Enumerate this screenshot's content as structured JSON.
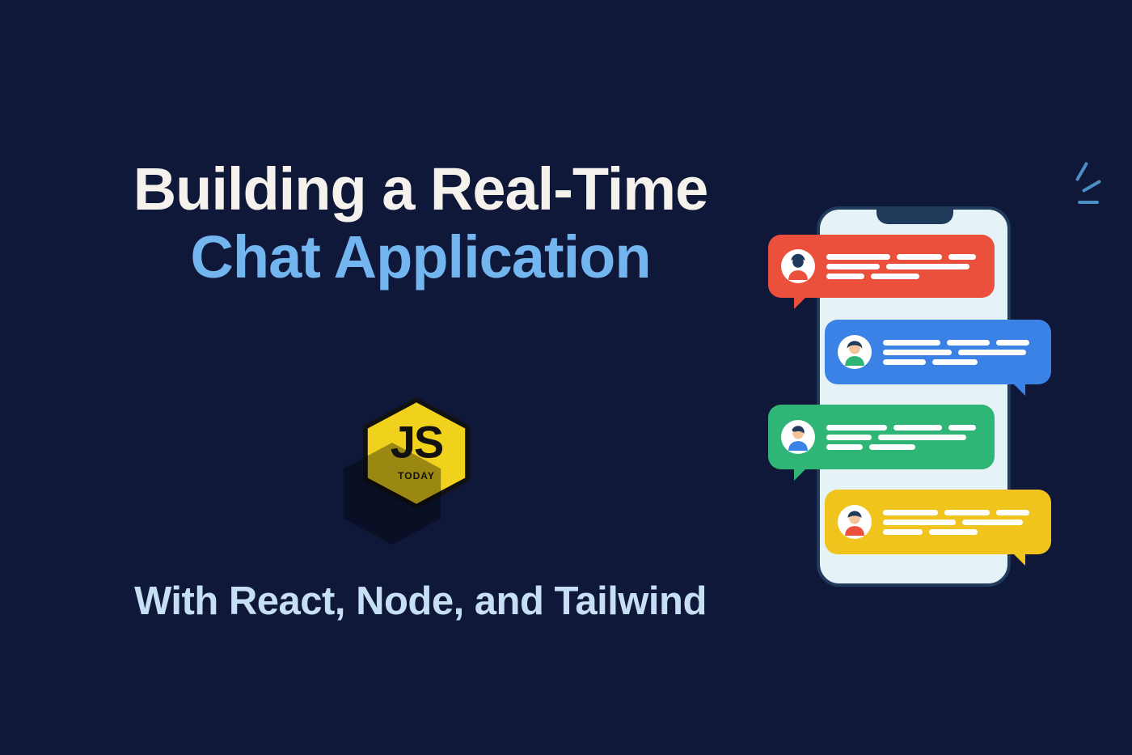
{
  "title": {
    "line1": "Building a Real-Time",
    "line2": "Chat Application"
  },
  "logo": {
    "text": "JS",
    "sub": "TODAY"
  },
  "subtitle": "With React, Node, and Tailwind",
  "colors": {
    "background": "#0f1838",
    "title_primary": "#f5f2ed",
    "title_accent": "#73b5ef",
    "subtitle": "#c6dff4",
    "logo_hex": "#f0d21c",
    "bubble_red": "#ea503b",
    "bubble_blue": "#3b82e6",
    "bubble_green": "#2fb576",
    "bubble_yellow": "#f0c41c",
    "phone_screen": "#e5f2f6",
    "phone_frame": "#1f3a5b"
  }
}
